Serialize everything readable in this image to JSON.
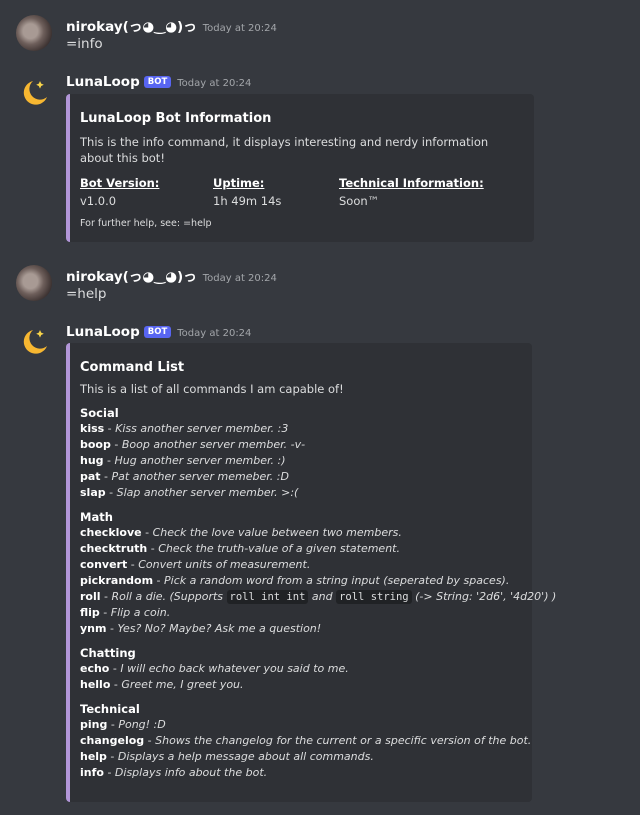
{
  "messages": [
    {
      "username": "nirokay(っ◕‿◕)っ",
      "timestamp": "Today at 20:24",
      "content": "=info"
    },
    {
      "username": "LunaLoop",
      "bot_tag": "BOT",
      "timestamp": "Today at 20:24"
    },
    {
      "username": "nirokay(っ◕‿◕)っ",
      "timestamp": "Today at 20:24",
      "content": "=help"
    },
    {
      "username": "LunaLoop",
      "bot_tag": "BOT",
      "timestamp": "Today at 20:24"
    }
  ],
  "info_embed": {
    "title": "LunaLoop Bot Information",
    "description": "This is the info command, it displays interesting and nerdy information about this bot!",
    "fields": [
      {
        "name": "Bot Version:",
        "value": "v1.0.0"
      },
      {
        "name": "Uptime:",
        "value": "1h 49m 14s"
      },
      {
        "name": "Technical Information:",
        "value": "Soon™"
      }
    ],
    "footer": "For further help, see: =help"
  },
  "help_embed": {
    "title": "Command List",
    "description": "This is a list of all commands I am capable of!",
    "sections": [
      {
        "title": "Social",
        "commands": [
          {
            "name": "kiss",
            "desc": "Kiss another server member. :3"
          },
          {
            "name": "boop",
            "desc": "Boop another server member. -v-"
          },
          {
            "name": "hug",
            "desc": "Hug another server member. :)"
          },
          {
            "name": "pat",
            "desc": "Pat another server memeber. :D"
          },
          {
            "name": "slap",
            "desc": "Slap another server member. >:("
          }
        ]
      },
      {
        "title": "Math",
        "commands": [
          {
            "name": "checklove",
            "desc": "Check the love value between two members."
          },
          {
            "name": "checktruth",
            "desc": "Check the truth-value of a given statement."
          },
          {
            "name": "convert",
            "desc": "Convert units of measurement."
          },
          {
            "name": "pickrandom",
            "desc": "Pick a random word from a string input (seperated by spaces)."
          },
          {
            "name": "roll",
            "desc_parts": [
              "Roll a die. (Supports ",
              "roll int int",
              " and ",
              "roll string",
              " (-> String: '2d6', '4d20') )"
            ]
          },
          {
            "name": "flip",
            "desc": "Flip a coin."
          },
          {
            "name": "ynm",
            "desc": "Yes? No? Maybe? Ask me a question!"
          }
        ]
      },
      {
        "title": "Chatting",
        "commands": [
          {
            "name": "echo",
            "desc": "I will echo back whatever you said to me."
          },
          {
            "name": "hello",
            "desc": "Greet me, I greet you."
          }
        ]
      },
      {
        "title": "Technical",
        "commands": [
          {
            "name": "ping",
            "desc": "Pong! :D"
          },
          {
            "name": "changelog",
            "desc": "Shows the changelog for the current or a specific version of the bot."
          },
          {
            "name": "help",
            "desc": "Displays a help message about all commands."
          },
          {
            "name": "info",
            "desc": "Displays info about the bot."
          }
        ]
      }
    ]
  }
}
